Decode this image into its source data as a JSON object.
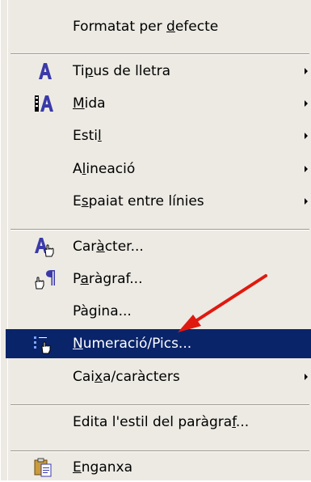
{
  "menu": {
    "items": [
      {
        "pre": "Formatat per ",
        "u": "d",
        "post": "efecte"
      },
      {
        "pre": "Ti",
        "u": "p",
        "post": "us de lletra",
        "icon": "font-icon"
      },
      {
        "pre": "",
        "u": "M",
        "post": "ida",
        "icon": "font-size-icon"
      },
      {
        "pre": "Esti",
        "u": "l",
        "post": ""
      },
      {
        "pre": "A",
        "u": "l",
        "post": "ineació"
      },
      {
        "pre": "E",
        "u": "s",
        "post": "paiat entre línies"
      },
      {
        "pre": "Car",
        "u": "à",
        "post": "cter...",
        "icon": "character-icon"
      },
      {
        "pre": "P",
        "u": "a",
        "post": "ràgraf...",
        "icon": "paragraph-icon"
      },
      {
        "pre": "Pàgina...",
        "u": "",
        "post": ""
      },
      {
        "pre": "",
        "u": "N",
        "post": "umeració/Pics...",
        "icon": "numbering-icon"
      },
      {
        "pre": "Cai",
        "u": "x",
        "post": "a/caràcters"
      },
      {
        "pre": "Edita l'estil del paràgra",
        "u": "f",
        "post": "..."
      },
      {
        "pre": "",
        "u": "E",
        "post": "nganxa",
        "icon": "paste-icon"
      }
    ]
  },
  "colors": {
    "highlight": "#0a246a",
    "menu_bg": "#eceae3",
    "icon_blue": "#3a3aa8",
    "annotation_arrow": "#e0190f"
  }
}
